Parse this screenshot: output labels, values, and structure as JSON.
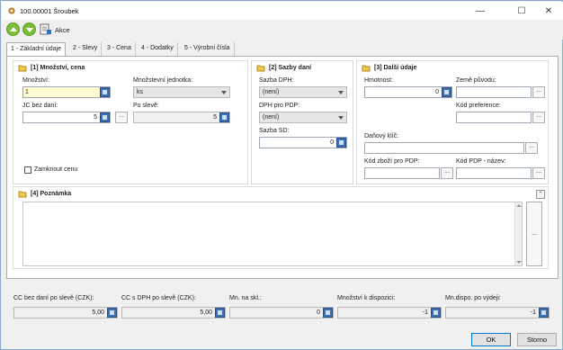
{
  "window": {
    "title": "100.00001 Šroubek",
    "minimize": "—",
    "maximize": "☐",
    "close": "✕"
  },
  "toolbar": {
    "actions_label": "Akce"
  },
  "tabs": [
    {
      "label": "1 - Základní údaje",
      "active": true
    },
    {
      "label": "2 - Slevy",
      "active": false
    },
    {
      "label": "3 - Cena",
      "active": false
    },
    {
      "label": "4 - Dodatky",
      "active": false
    },
    {
      "label": "5 - Výrobní čísla",
      "active": false
    }
  ],
  "group1": {
    "title": "[1] Množství, cena",
    "quantity_label": "Množství:",
    "quantity_value": "1",
    "unit_label": "Množstevní jednotka:",
    "unit_value": "ks",
    "unit_price_label": "JC bez daní:",
    "unit_price_value": "5",
    "after_discount_label": "Po slevě:",
    "after_discount_value": "5",
    "lock_price_label": "Zamknout cenu",
    "dots": "..."
  },
  "group2": {
    "title": "[2] Sazby daní",
    "vat_rate_label": "Sazba DPH:",
    "vat_rate_value": "(není)",
    "vat_pdp_label": "DPH pro PDP:",
    "vat_pdp_value": "(není)",
    "sd_rate_label": "Sazba SD:",
    "sd_rate_value": "0"
  },
  "group3": {
    "title": "[3] Další údaje",
    "weight_label": "Hmotnost:",
    "weight_value": "0",
    "origin_label": "Země původu:",
    "preference_label": "Kód preference:",
    "tax_key_label": "Daňový klíč:",
    "goods_code_label": "Kód zboží pro PDP:",
    "pdp_code_label": "Kód PDP - název:",
    "dots": "..."
  },
  "group4": {
    "title": "[4] Poznámka",
    "collapse": "⌃",
    "dots": "..."
  },
  "footer": {
    "fields": [
      {
        "label": "CC bez daní po slevě (CZK):",
        "value": "5,00"
      },
      {
        "label": "CC s DPH po slevě (CZK):",
        "value": "5,00"
      },
      {
        "label": "Mn. na skl.:",
        "value": "0"
      },
      {
        "label": "Množství k dispozici:",
        "value": "-1"
      },
      {
        "label": "Mn.dispo. po výdeji:",
        "value": "-1"
      }
    ],
    "ok_label": "OK",
    "cancel_label": "Storno"
  }
}
